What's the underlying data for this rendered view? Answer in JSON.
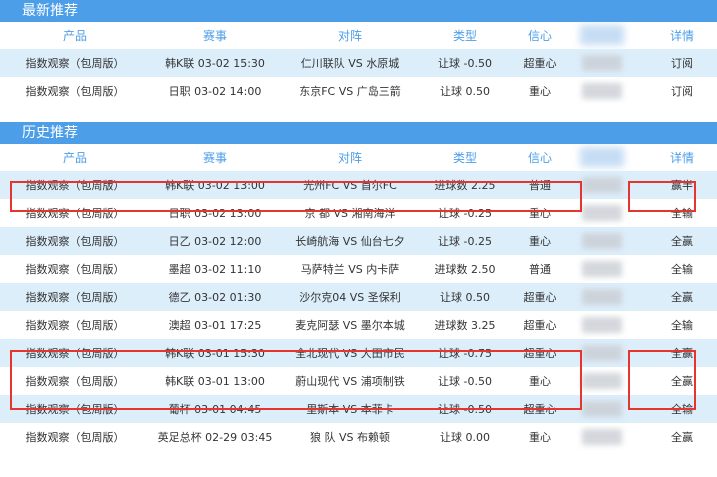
{
  "latest": {
    "title": "最新推荐",
    "columns": [
      "产品",
      "赛事",
      "对阵",
      "类型",
      "信心",
      "详情"
    ],
    "rows": [
      {
        "product": "指数观察（包周版）",
        "match": "韩K联 03-02 15:30",
        "vs": "仁川联队 VS 水原城",
        "type": "让球 -0.50",
        "confidence": "超重心",
        "detail": "订阅"
      },
      {
        "product": "指数观察（包周版）",
        "match": "日职 03-02 14:00",
        "vs": "东京FC VS 广岛三箭",
        "type": "让球 0.50",
        "confidence": "重心",
        "detail": "订阅"
      }
    ]
  },
  "history": {
    "title": "历史推荐",
    "columns": [
      "产品",
      "赛事",
      "对阵",
      "类型",
      "信心",
      "详情"
    ],
    "rows": [
      {
        "product": "指数观察（包周版）",
        "match": "韩K联 03-02 13:00",
        "vs": "光州FC VS 首尔FC",
        "type": "进球数 2.25",
        "confidence": "普通",
        "detail": "赢半"
      },
      {
        "product": "指数观察（包周版）",
        "match": "日职 03-02 13:00",
        "vs": "京 都 VS 湘南海洋",
        "type": "让球 -0.25",
        "confidence": "重心",
        "detail": "全输"
      },
      {
        "product": "指数观察（包周版）",
        "match": "日乙 03-02 12:00",
        "vs": "长崎航海 VS 仙台七夕",
        "type": "让球 -0.25",
        "confidence": "重心",
        "detail": "全赢"
      },
      {
        "product": "指数观察（包周版）",
        "match": "墨超 03-02 11:10",
        "vs": "马萨特兰 VS 内卡萨",
        "type": "进球数 2.50",
        "confidence": "普通",
        "detail": "全输"
      },
      {
        "product": "指数观察（包周版）",
        "match": "德乙 03-02 01:30",
        "vs": "沙尔克04 VS 圣保利",
        "type": "让球 0.50",
        "confidence": "超重心",
        "detail": "全赢"
      },
      {
        "product": "指数观察（包周版）",
        "match": "澳超 03-01 17:25",
        "vs": "麦克阿瑟 VS 墨尔本城",
        "type": "进球数 3.25",
        "confidence": "超重心",
        "detail": "全输"
      },
      {
        "product": "指数观察（包周版）",
        "match": "韩K联 03-01 15:30",
        "vs": "全北现代 VS 大田市民",
        "type": "让球 -0.75",
        "confidence": "超重心",
        "detail": "全赢"
      },
      {
        "product": "指数观察（包周版）",
        "match": "韩K联 03-01 13:00",
        "vs": "蔚山现代 VS 浦项制铁",
        "type": "让球 -0.50",
        "confidence": "重心",
        "detail": "全赢"
      },
      {
        "product": "指数观察（包周版）",
        "match": "葡杯 03-01 04:45",
        "vs": "里斯本 VS 本菲卡",
        "type": "让球 -0.50",
        "confidence": "超重心",
        "detail": "全输"
      },
      {
        "product": "指数观察（包周版）",
        "match": "英足总杯 02-29 03:45",
        "vs": "狼 队 VS 布赖顿",
        "type": "让球 0.00",
        "confidence": "重心",
        "detail": "全赢"
      }
    ]
  },
  "colors": {
    "header_bg": "#4d9ee8",
    "row_alt": "#ddeefb",
    "highlight": "#e6342f"
  }
}
